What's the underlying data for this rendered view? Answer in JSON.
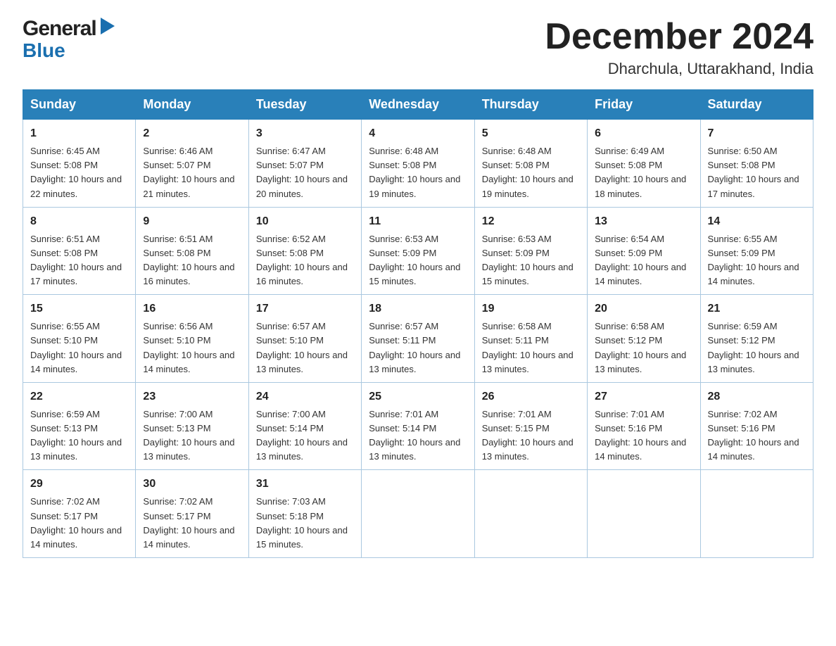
{
  "header": {
    "logo_general": "General",
    "logo_blue": "Blue",
    "month_title": "December 2024",
    "location": "Dharchula, Uttarakhand, India"
  },
  "days_of_week": [
    "Sunday",
    "Monday",
    "Tuesday",
    "Wednesday",
    "Thursday",
    "Friday",
    "Saturday"
  ],
  "weeks": [
    [
      {
        "day": "1",
        "sunrise": "6:45 AM",
        "sunset": "5:08 PM",
        "daylight": "10 hours and 22 minutes."
      },
      {
        "day": "2",
        "sunrise": "6:46 AM",
        "sunset": "5:07 PM",
        "daylight": "10 hours and 21 minutes."
      },
      {
        "day": "3",
        "sunrise": "6:47 AM",
        "sunset": "5:07 PM",
        "daylight": "10 hours and 20 minutes."
      },
      {
        "day": "4",
        "sunrise": "6:48 AM",
        "sunset": "5:08 PM",
        "daylight": "10 hours and 19 minutes."
      },
      {
        "day": "5",
        "sunrise": "6:48 AM",
        "sunset": "5:08 PM",
        "daylight": "10 hours and 19 minutes."
      },
      {
        "day": "6",
        "sunrise": "6:49 AM",
        "sunset": "5:08 PM",
        "daylight": "10 hours and 18 minutes."
      },
      {
        "day": "7",
        "sunrise": "6:50 AM",
        "sunset": "5:08 PM",
        "daylight": "10 hours and 17 minutes."
      }
    ],
    [
      {
        "day": "8",
        "sunrise": "6:51 AM",
        "sunset": "5:08 PM",
        "daylight": "10 hours and 17 minutes."
      },
      {
        "day": "9",
        "sunrise": "6:51 AM",
        "sunset": "5:08 PM",
        "daylight": "10 hours and 16 minutes."
      },
      {
        "day": "10",
        "sunrise": "6:52 AM",
        "sunset": "5:08 PM",
        "daylight": "10 hours and 16 minutes."
      },
      {
        "day": "11",
        "sunrise": "6:53 AM",
        "sunset": "5:09 PM",
        "daylight": "10 hours and 15 minutes."
      },
      {
        "day": "12",
        "sunrise": "6:53 AM",
        "sunset": "5:09 PM",
        "daylight": "10 hours and 15 minutes."
      },
      {
        "day": "13",
        "sunrise": "6:54 AM",
        "sunset": "5:09 PM",
        "daylight": "10 hours and 14 minutes."
      },
      {
        "day": "14",
        "sunrise": "6:55 AM",
        "sunset": "5:09 PM",
        "daylight": "10 hours and 14 minutes."
      }
    ],
    [
      {
        "day": "15",
        "sunrise": "6:55 AM",
        "sunset": "5:10 PM",
        "daylight": "10 hours and 14 minutes."
      },
      {
        "day": "16",
        "sunrise": "6:56 AM",
        "sunset": "5:10 PM",
        "daylight": "10 hours and 14 minutes."
      },
      {
        "day": "17",
        "sunrise": "6:57 AM",
        "sunset": "5:10 PM",
        "daylight": "10 hours and 13 minutes."
      },
      {
        "day": "18",
        "sunrise": "6:57 AM",
        "sunset": "5:11 PM",
        "daylight": "10 hours and 13 minutes."
      },
      {
        "day": "19",
        "sunrise": "6:58 AM",
        "sunset": "5:11 PM",
        "daylight": "10 hours and 13 minutes."
      },
      {
        "day": "20",
        "sunrise": "6:58 AM",
        "sunset": "5:12 PM",
        "daylight": "10 hours and 13 minutes."
      },
      {
        "day": "21",
        "sunrise": "6:59 AM",
        "sunset": "5:12 PM",
        "daylight": "10 hours and 13 minutes."
      }
    ],
    [
      {
        "day": "22",
        "sunrise": "6:59 AM",
        "sunset": "5:13 PM",
        "daylight": "10 hours and 13 minutes."
      },
      {
        "day": "23",
        "sunrise": "7:00 AM",
        "sunset": "5:13 PM",
        "daylight": "10 hours and 13 minutes."
      },
      {
        "day": "24",
        "sunrise": "7:00 AM",
        "sunset": "5:14 PM",
        "daylight": "10 hours and 13 minutes."
      },
      {
        "day": "25",
        "sunrise": "7:01 AM",
        "sunset": "5:14 PM",
        "daylight": "10 hours and 13 minutes."
      },
      {
        "day": "26",
        "sunrise": "7:01 AM",
        "sunset": "5:15 PM",
        "daylight": "10 hours and 13 minutes."
      },
      {
        "day": "27",
        "sunrise": "7:01 AM",
        "sunset": "5:16 PM",
        "daylight": "10 hours and 14 minutes."
      },
      {
        "day": "28",
        "sunrise": "7:02 AM",
        "sunset": "5:16 PM",
        "daylight": "10 hours and 14 minutes."
      }
    ],
    [
      {
        "day": "29",
        "sunrise": "7:02 AM",
        "sunset": "5:17 PM",
        "daylight": "10 hours and 14 minutes."
      },
      {
        "day": "30",
        "sunrise": "7:02 AM",
        "sunset": "5:17 PM",
        "daylight": "10 hours and 14 minutes."
      },
      {
        "day": "31",
        "sunrise": "7:03 AM",
        "sunset": "5:18 PM",
        "daylight": "10 hours and 15 minutes."
      },
      null,
      null,
      null,
      null
    ]
  ]
}
